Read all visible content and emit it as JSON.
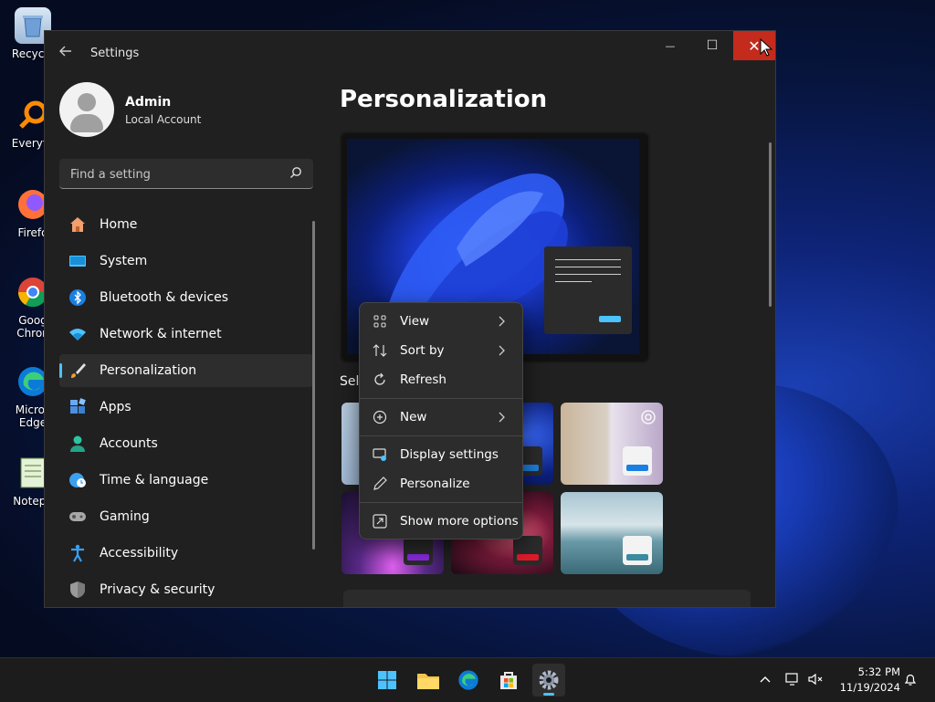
{
  "desktop": {
    "icons": [
      {
        "label": "Recycle",
        "icon": "recycle-bin-icon"
      },
      {
        "label": "Everyth",
        "icon": "everything-search-icon"
      },
      {
        "label": "Firefo",
        "icon": "firefox-icon"
      },
      {
        "label": "Goog Chron",
        "icon": "chrome-icon"
      },
      {
        "label": "Micros Edge",
        "icon": "edge-icon"
      },
      {
        "label": "Notepa",
        "icon": "notepad-icon"
      }
    ]
  },
  "window": {
    "title": "Settings",
    "controls": {
      "minimize": "—",
      "maximize": "☐",
      "close": "✕"
    }
  },
  "profile": {
    "name": "Admin",
    "account_type": "Local Account"
  },
  "search": {
    "placeholder": "Find a setting"
  },
  "sidebar": {
    "items": [
      {
        "label": "Home",
        "icon": "home-icon",
        "active": false
      },
      {
        "label": "System",
        "icon": "system-display-icon",
        "active": false
      },
      {
        "label": "Bluetooth & devices",
        "icon": "bluetooth-icon",
        "active": false
      },
      {
        "label": "Network & internet",
        "icon": "wifi-icon",
        "active": false
      },
      {
        "label": "Personalization",
        "icon": "paintbrush-icon",
        "active": true
      },
      {
        "label": "Apps",
        "icon": "apps-icon",
        "active": false
      },
      {
        "label": "Accounts",
        "icon": "accounts-icon",
        "active": false
      },
      {
        "label": "Time & language",
        "icon": "globe-clock-icon",
        "active": false
      },
      {
        "label": "Gaming",
        "icon": "gamepad-icon",
        "active": false
      },
      {
        "label": "Accessibility",
        "icon": "accessibility-icon",
        "active": false
      },
      {
        "label": "Privacy & security",
        "icon": "shield-icon",
        "active": false
      }
    ]
  },
  "main": {
    "title": "Personalization",
    "section_label": "Sel",
    "accent": "#4cc2ff"
  },
  "context_menu": {
    "items": [
      {
        "label": "View",
        "icon": "view-grid-icon",
        "submenu": true
      },
      {
        "label": "Sort by",
        "icon": "sort-icon",
        "submenu": true
      },
      {
        "label": "Refresh",
        "icon": "refresh-icon",
        "submenu": false
      },
      {
        "label": "New",
        "icon": "new-plus-icon",
        "submenu": true
      },
      {
        "label": "Display settings",
        "icon": "display-settings-icon",
        "submenu": false
      },
      {
        "label": "Personalize",
        "icon": "pen-icon",
        "submenu": false
      },
      {
        "label": "Show more options",
        "icon": "more-options-icon",
        "submenu": false
      }
    ]
  },
  "taskbar": {
    "apps": [
      {
        "name": "start",
        "icon": "windows-start-icon"
      },
      {
        "name": "file-explorer",
        "icon": "folder-icon"
      },
      {
        "name": "edge",
        "icon": "edge-icon"
      },
      {
        "name": "store",
        "icon": "store-icon"
      },
      {
        "name": "settings",
        "icon": "gear-icon",
        "active": true
      }
    ],
    "time": "5:32 PM",
    "date": "11/19/2024"
  }
}
